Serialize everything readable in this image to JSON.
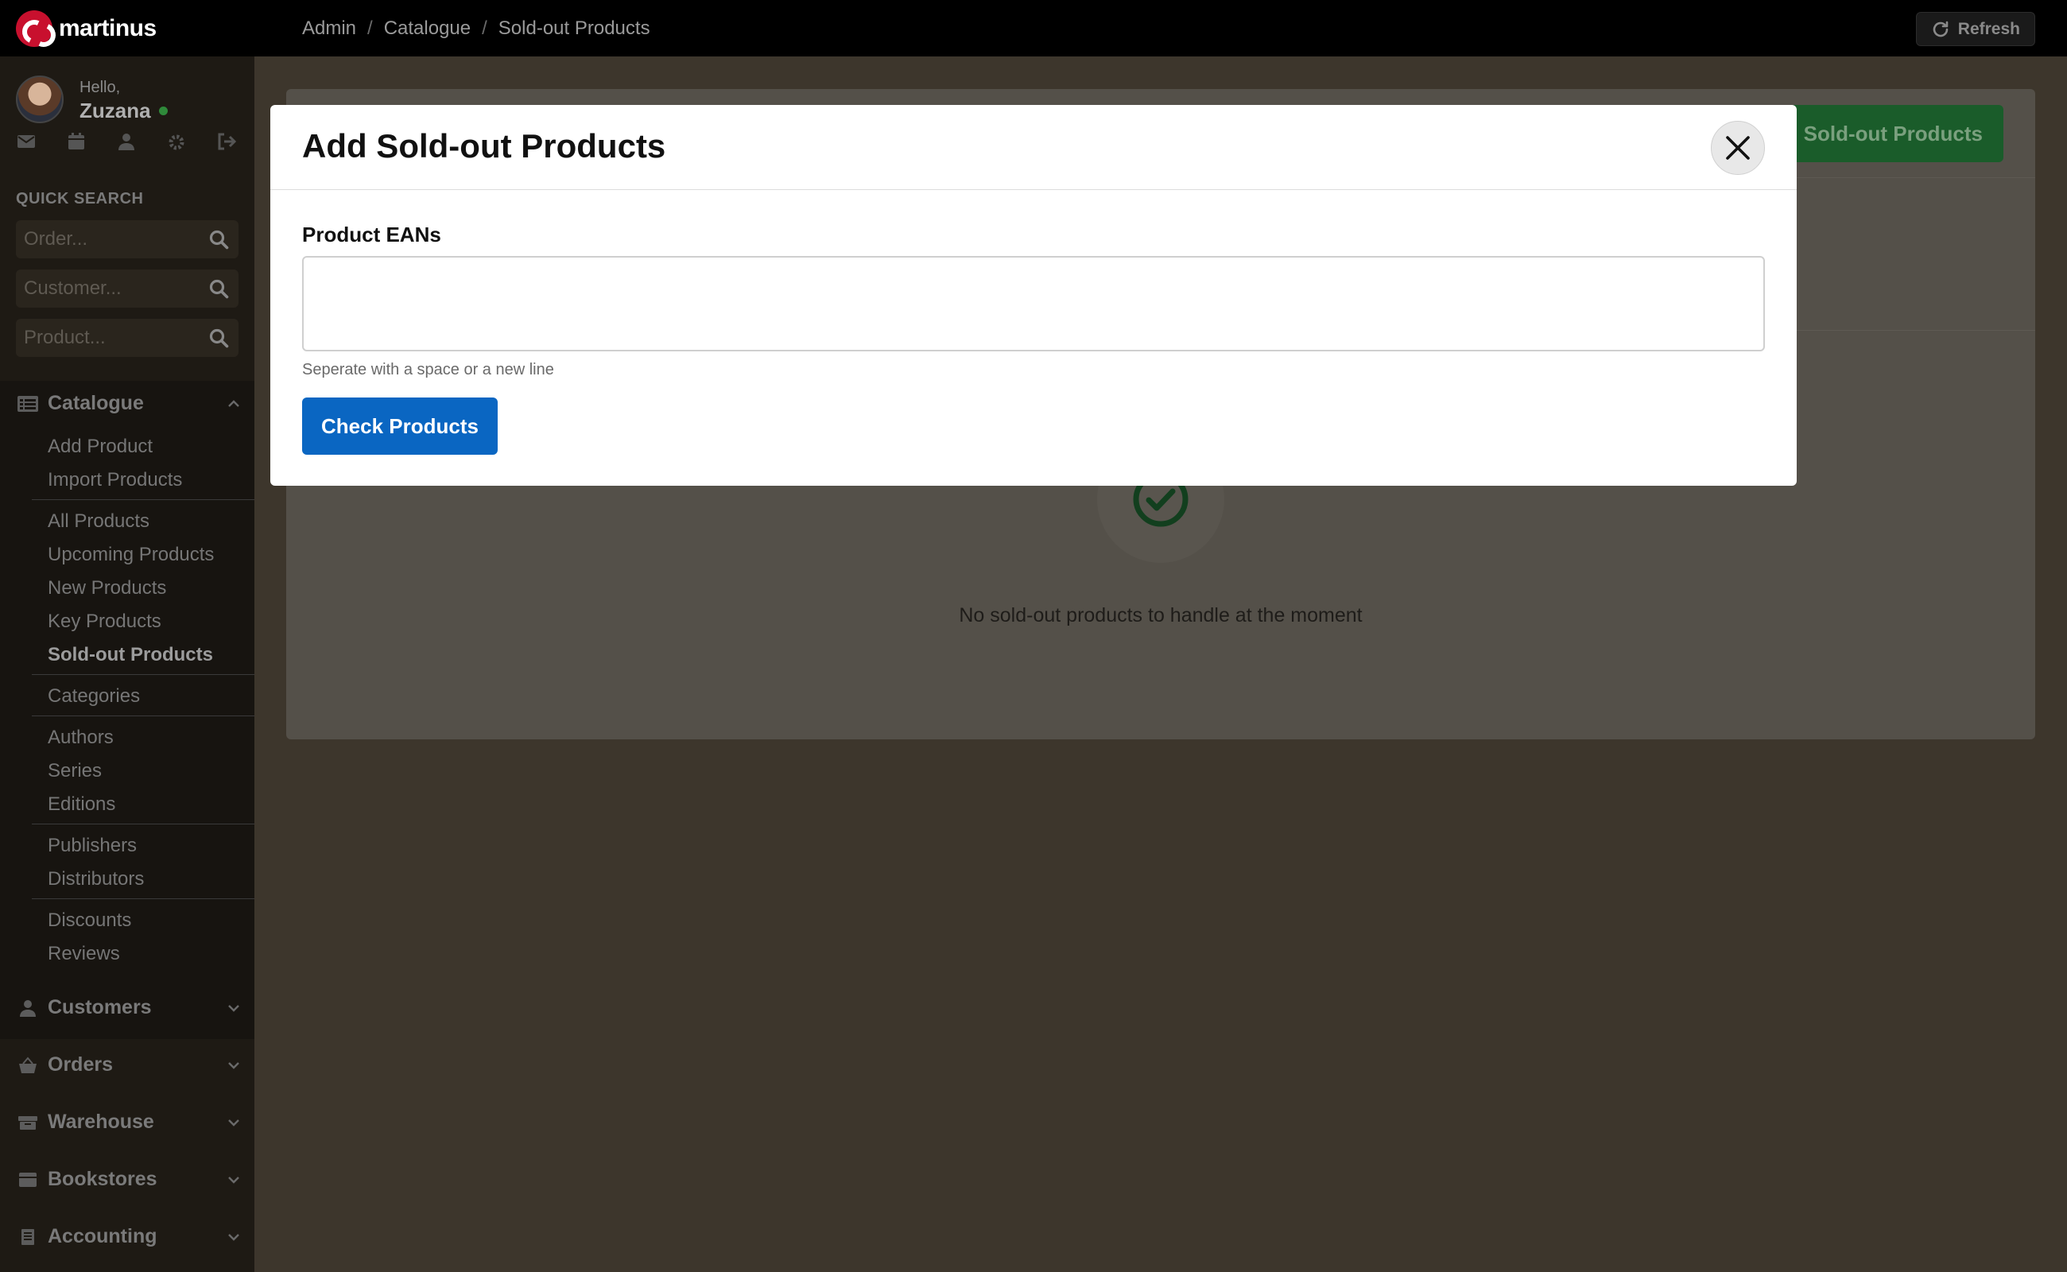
{
  "app": {
    "brand": "martinus",
    "brand_color": "#c8102e"
  },
  "breadcrumb": [
    "Admin",
    "Catalogue",
    "Sold-out Products"
  ],
  "toolbar": {
    "refresh_label": "Refresh"
  },
  "user": {
    "greeting": "Hello,",
    "name": "Zuzana",
    "status": "online"
  },
  "user_icons": [
    "mail-icon",
    "calendar-icon",
    "user-icon",
    "gear-icon",
    "logout-icon"
  ],
  "quick_search": {
    "title": "QUICK SEARCH",
    "fields": [
      {
        "placeholder": "Order..."
      },
      {
        "placeholder": "Customer..."
      },
      {
        "placeholder": "Product..."
      }
    ]
  },
  "sidebar": {
    "catalogue": {
      "label": "Catalogue",
      "groups": [
        [
          "Add Product",
          "Import Products"
        ],
        [
          "All Products",
          "Upcoming Products",
          "New Products",
          "Key Products",
          "Sold-out Products"
        ],
        [
          "Categories"
        ],
        [
          "Authors",
          "Series",
          "Editions"
        ],
        [
          "Publishers",
          "Distributors"
        ],
        [
          "Discounts",
          "Reviews"
        ]
      ],
      "active": "Sold-out Products"
    },
    "sections": [
      "Customers",
      "Orders",
      "Warehouse",
      "Bookstores",
      "Accounting"
    ]
  },
  "main": {
    "add_button_label": "Add Sold-out Products",
    "empty_message": "No sold-out products to handle at the moment",
    "accent": "#1a5c2a"
  },
  "modal": {
    "title": "Add Sold-out Products",
    "field_label": "Product EANs",
    "field_value": "",
    "help_text": "Seperate with a space or a new line",
    "submit_label": "Check Products",
    "submit_color": "#0a66c2"
  }
}
